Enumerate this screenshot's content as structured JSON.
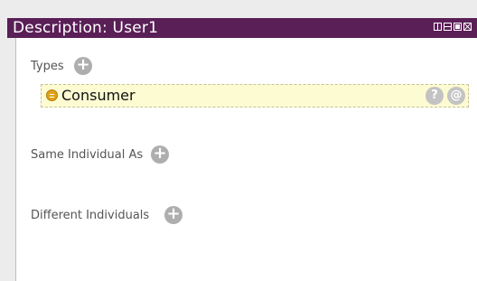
{
  "window": {
    "title": "Description: User1",
    "title_bar_color": "#5a1f57",
    "controls": [
      "view-icon",
      "minimize-icon",
      "maximize-icon",
      "close-icon"
    ]
  },
  "sections": {
    "types": {
      "label": "Types",
      "add_icon": "+",
      "items": [
        {
          "name": "Consumer",
          "icon": "class-icon",
          "help_label": "?",
          "annotation_label": "@"
        }
      ]
    },
    "same_individual": {
      "label": "Same Individual As",
      "add_icon": "+"
    },
    "different_individuals": {
      "label": "Different Individuals",
      "add_icon": "+"
    }
  },
  "colors": {
    "row_highlight": "#fdfbd2",
    "class_icon": "#e0a21a",
    "button_grey": "#aeaeae"
  }
}
